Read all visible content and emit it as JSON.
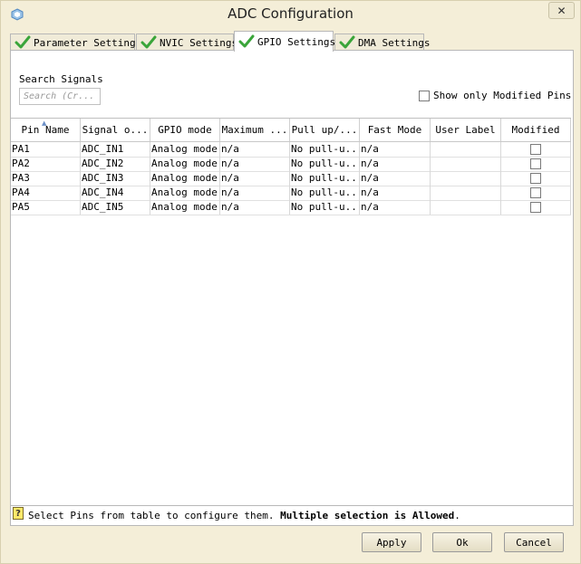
{
  "window": {
    "title": "ADC Configuration",
    "close_glyph": "✕"
  },
  "tabs": [
    {
      "label": "Parameter Settings",
      "active": false
    },
    {
      "label": "NVIC Settings",
      "active": false
    },
    {
      "label": "GPIO Settings",
      "active": true
    },
    {
      "label": "DMA Settings",
      "active": false
    }
  ],
  "search": {
    "label": "Search Signals",
    "placeholder": "Search (Cr..."
  },
  "filter": {
    "show_modified_label": "Show only Modified Pins",
    "checked": false
  },
  "table": {
    "headers": [
      "Pin Name",
      "Signal o...",
      "GPIO mode",
      "Maximum ...",
      "Pull up/...",
      "Fast Mode",
      "User Label",
      "Modified"
    ],
    "rows": [
      {
        "pin": "PA1",
        "signal": "ADC_IN1",
        "mode": "Analog mode",
        "max": "n/a",
        "pull": "No pull-u...",
        "fast": "n/a",
        "label": "",
        "modified": false
      },
      {
        "pin": "PA2",
        "signal": "ADC_IN2",
        "mode": "Analog mode",
        "max": "n/a",
        "pull": "No pull-u...",
        "fast": "n/a",
        "label": "",
        "modified": false
      },
      {
        "pin": "PA3",
        "signal": "ADC_IN3",
        "mode": "Analog mode",
        "max": "n/a",
        "pull": "No pull-u...",
        "fast": "n/a",
        "label": "",
        "modified": false
      },
      {
        "pin": "PA4",
        "signal": "ADC_IN4",
        "mode": "Analog mode",
        "max": "n/a",
        "pull": "No pull-u...",
        "fast": "n/a",
        "label": "",
        "modified": false
      },
      {
        "pin": "PA5",
        "signal": "ADC_IN5",
        "mode": "Analog mode",
        "max": "n/a",
        "pull": "No pull-u...",
        "fast": "n/a",
        "label": "",
        "modified": false
      }
    ]
  },
  "status": {
    "help_glyph": "?",
    "text": "Select Pins from table to configure them. ",
    "bold": "Multiple selection is Allowed",
    "suffix": "."
  },
  "buttons": {
    "apply": "Apply",
    "ok": "Ok",
    "cancel": "Cancel"
  },
  "colors": {
    "check_green": "#3aa53a",
    "window_bg": "#f4eed8"
  }
}
